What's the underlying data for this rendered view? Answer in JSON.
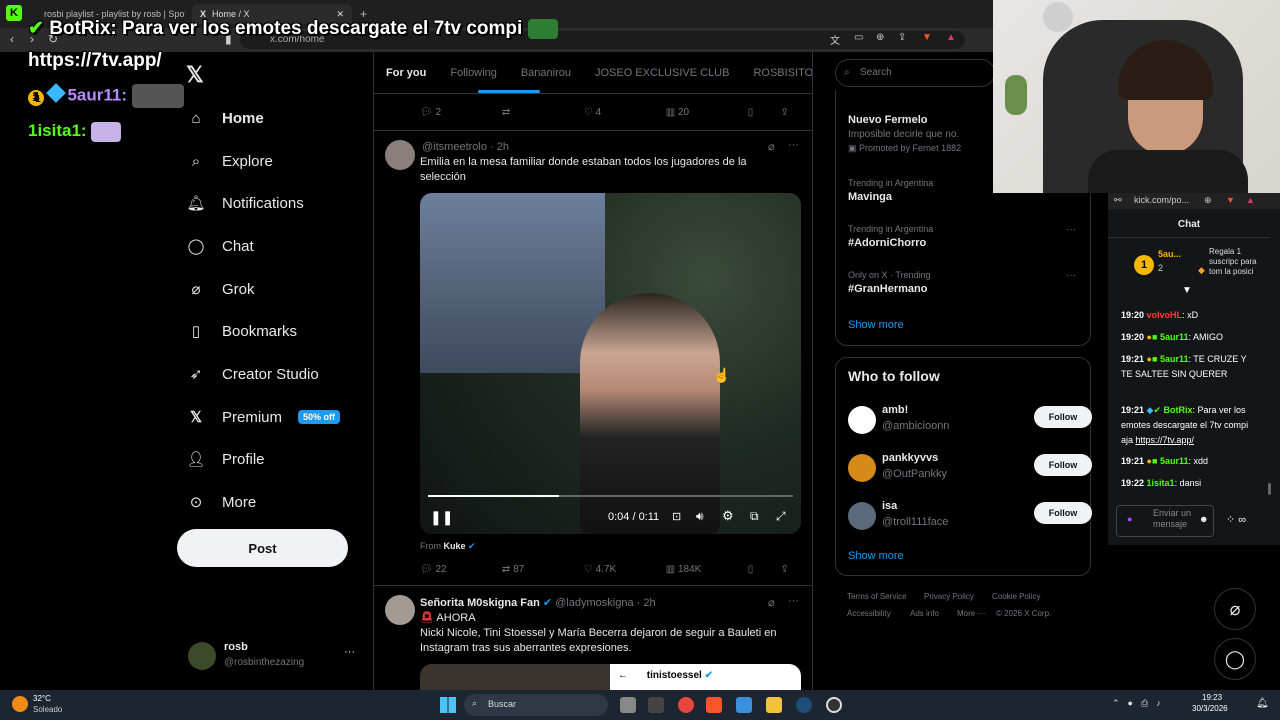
{
  "browser": {
    "tabs": [
      {
        "label": "rosbi playlist - playlist by rosb | Spoti"
      },
      {
        "label": "Home / X"
      }
    ],
    "new_tab": "+",
    "url": "x.com/home"
  },
  "overlay": {
    "botrix_message": "BotRix: Para ver los emotes descargate el 7tv compi",
    "link": "https://7tv.app/",
    "user1": "5aur11:",
    "user2": "1isita1:"
  },
  "sidebar": {
    "items": [
      {
        "label": "Home",
        "icon": "home-icon"
      },
      {
        "label": "Explore",
        "icon": "search-icon"
      },
      {
        "label": "Notifications",
        "icon": "bell-icon"
      },
      {
        "label": "Chat",
        "icon": "chat-icon"
      },
      {
        "label": "Grok",
        "icon": "grok-icon"
      },
      {
        "label": "Bookmarks",
        "icon": "bookmark-icon"
      },
      {
        "label": "Creator Studio",
        "icon": "rocket-icon"
      },
      {
        "label": "Premium",
        "icon": "x-icon"
      },
      {
        "label": "Profile",
        "icon": "profile-icon"
      },
      {
        "label": "More",
        "icon": "more-circle-icon"
      }
    ],
    "premium_badge": "50% off",
    "post_label": "Post",
    "account_name": "rosb",
    "account_handle": "@rosbinthezazing",
    "account_more": "···"
  },
  "feed": {
    "tabs": [
      "For you",
      "Following",
      "Bananirou",
      "JOSEO EXCLUSIVE CLUB",
      "ROSBISITOS"
    ],
    "top_metrics": {
      "replies": "2",
      "likes": "4",
      "views": "20"
    },
    "tweet1": {
      "handle_time": "@itsmeetrolo · 2h",
      "text": "Emilia en la mesa familiar donde estaban todos los jugadores de la selección",
      "video_time": "0:04 / 0:11",
      "video_progress": 0.36,
      "from_label": "From",
      "from_name": "Kuke",
      "metrics": {
        "replies": "22",
        "retweets": "87",
        "likes": "4.7K",
        "views": "184K"
      }
    },
    "tweet2": {
      "name": "Señorita M0skigna Fan",
      "handle_time": "@ladymoskigna · 2h",
      "line1": "AHORA",
      "text": "Nicki Nicole, Tini Stoessel y María Becerra dejaron de seguir a Bauleti en Instagram tras sus aberrantes expresiones.",
      "embed_user": "tinistoessel"
    }
  },
  "right": {
    "search_placeholder": "Search",
    "trends": [
      {
        "title": "Nuevo Fermelo",
        "sub": "Imposible decirle que no.",
        "promo": "Promoted by Fernet 1882"
      },
      {
        "sub": "Trending in Argentina",
        "title": "Mavinga"
      },
      {
        "sub": "Trending in Argentina",
        "title": "#AdorniChorro"
      },
      {
        "sub": "Only on X · Trending",
        "title": "#GranHermano"
      }
    ],
    "show_more": "Show more",
    "who_to_follow": "Who to follow",
    "follow": [
      {
        "name": "amb!",
        "handle": "@ambicioonn",
        "button": "Follow"
      },
      {
        "name": "pankkyvvs",
        "handle": "@OutPankky",
        "button": "Follow"
      },
      {
        "name": "isa",
        "handle": "@troll111face",
        "button": "Follow"
      }
    ],
    "footer": [
      "Terms of Service",
      "Privacy Policy",
      "Cookie Policy",
      "Accessibility",
      "Ads info",
      "More ···",
      "© 2026 X Corp."
    ]
  },
  "kick": {
    "url": "kick.com/po...",
    "title": "Chat",
    "sub_user": "5au...",
    "sub_count": "2",
    "gift_text": "Regala 1 suscripc para tom la posici",
    "messages": [
      {
        "time": "19:20",
        "user": "volvoHL",
        "text": ": xD"
      },
      {
        "time": "19:20",
        "user": "5aur11",
        "text": ": AMIGO"
      },
      {
        "time": "19:21",
        "user": "5aur11",
        "text": ": TE CRUZE Y TE SALTEE SIN QUERER"
      },
      {
        "time": "19:21",
        "user": "BotRix",
        "text": ": Para ver los emotes descargate el 7tv compi aja ",
        "link": "https://7tv.app/"
      },
      {
        "time": "19:21",
        "user": "5aur11",
        "text": ": xdd"
      },
      {
        "time": "19:22",
        "user": "1isita1",
        "text": ": dansi"
      }
    ],
    "input_placeholder": "Enviar un mensaje"
  },
  "taskbar": {
    "weather_temp": "32°C",
    "weather_desc": "Soleado",
    "search": "Buscar",
    "time": "19:23",
    "date": "30/3/2026"
  }
}
